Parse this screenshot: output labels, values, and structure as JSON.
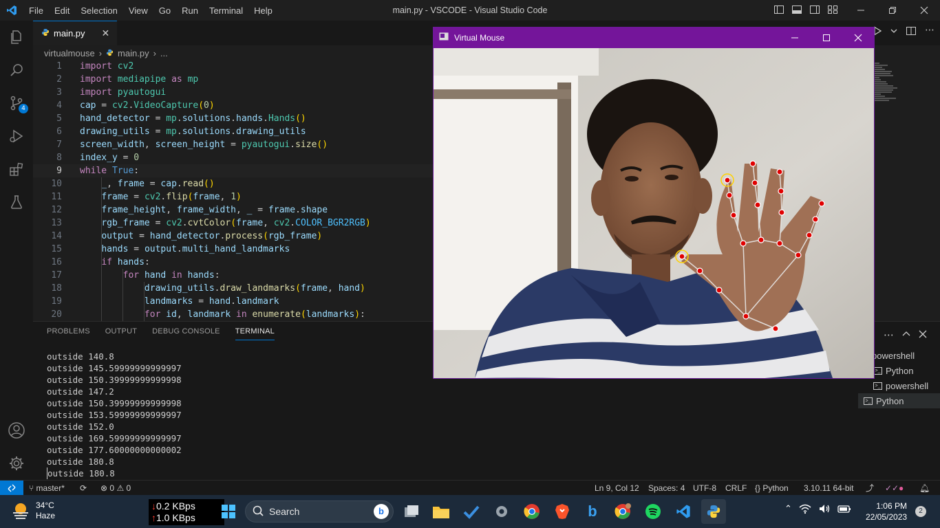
{
  "window": {
    "title": "main.py - VSCODE - Visual Studio Code",
    "menu": [
      "File",
      "Edit",
      "Selection",
      "View",
      "Go",
      "Run",
      "Terminal",
      "Help"
    ]
  },
  "activity_bar": {
    "items": [
      "explorer-icon",
      "search-icon",
      "source-control-icon",
      "run-debug-icon",
      "extensions-icon",
      "testing-icon"
    ],
    "source_control_badge": "4",
    "bottom": [
      "accounts-icon",
      "manage-gear-icon"
    ]
  },
  "tabs": [
    {
      "label": "main.py",
      "close": "✕"
    }
  ],
  "breadcrumb": {
    "folder": "virtualmouse",
    "file": "main.py",
    "more": "..."
  },
  "code_lines": [
    {
      "no": "1"
    },
    {
      "no": "2"
    },
    {
      "no": "3"
    },
    {
      "no": "4"
    },
    {
      "no": "5"
    },
    {
      "no": "6"
    },
    {
      "no": "7"
    },
    {
      "no": "8"
    },
    {
      "no": "9"
    },
    {
      "no": "10"
    },
    {
      "no": "11"
    },
    {
      "no": "12"
    },
    {
      "no": "13"
    },
    {
      "no": "14"
    },
    {
      "no": "15"
    },
    {
      "no": "16"
    },
    {
      "no": "17"
    },
    {
      "no": "18"
    },
    {
      "no": "19"
    },
    {
      "no": "20"
    }
  ],
  "panel": {
    "tabs": [
      "PROBLEMS",
      "OUTPUT",
      "DEBUG CONSOLE",
      "TERMINAL"
    ],
    "active_tab": "TERMINAL",
    "terminal_lines": [
      "outside 140.8",
      "outside 145.59999999999997",
      "outside 150.39999999999998",
      "outside 147.2",
      "outside 150.39999999999998",
      "outside 153.59999999999997",
      "outside 152.0",
      "outside 169.59999999999997",
      "outside 177.60000000000002",
      "outside 180.8",
      "outside 180.8"
    ],
    "terminals": [
      "powershell",
      "Python",
      "powershell",
      "Python"
    ]
  },
  "virtual_mouse": {
    "title": "Virtual Mouse"
  },
  "status_bar": {
    "branch": "master*",
    "errors": "0",
    "warnings": "0",
    "position": "Ln 9, Col 12",
    "spaces": "Spaces: 4",
    "encoding": "UTF-8",
    "eol": "CRLF",
    "language": "Python",
    "interpreter": "3.10.11 64-bit"
  },
  "taskbar": {
    "weather_temp": "34°C",
    "weather_desc": "Haze",
    "net_down": "0.2 KBps",
    "net_up": "1.0 KBps",
    "search_placeholder": "Search",
    "time": "1:06 PM",
    "date": "22/05/2023",
    "notifications": "2"
  },
  "colors": {
    "accent": "#0078d4",
    "virtual_mouse_frame": "#74159a",
    "landmark": "#e00000"
  }
}
